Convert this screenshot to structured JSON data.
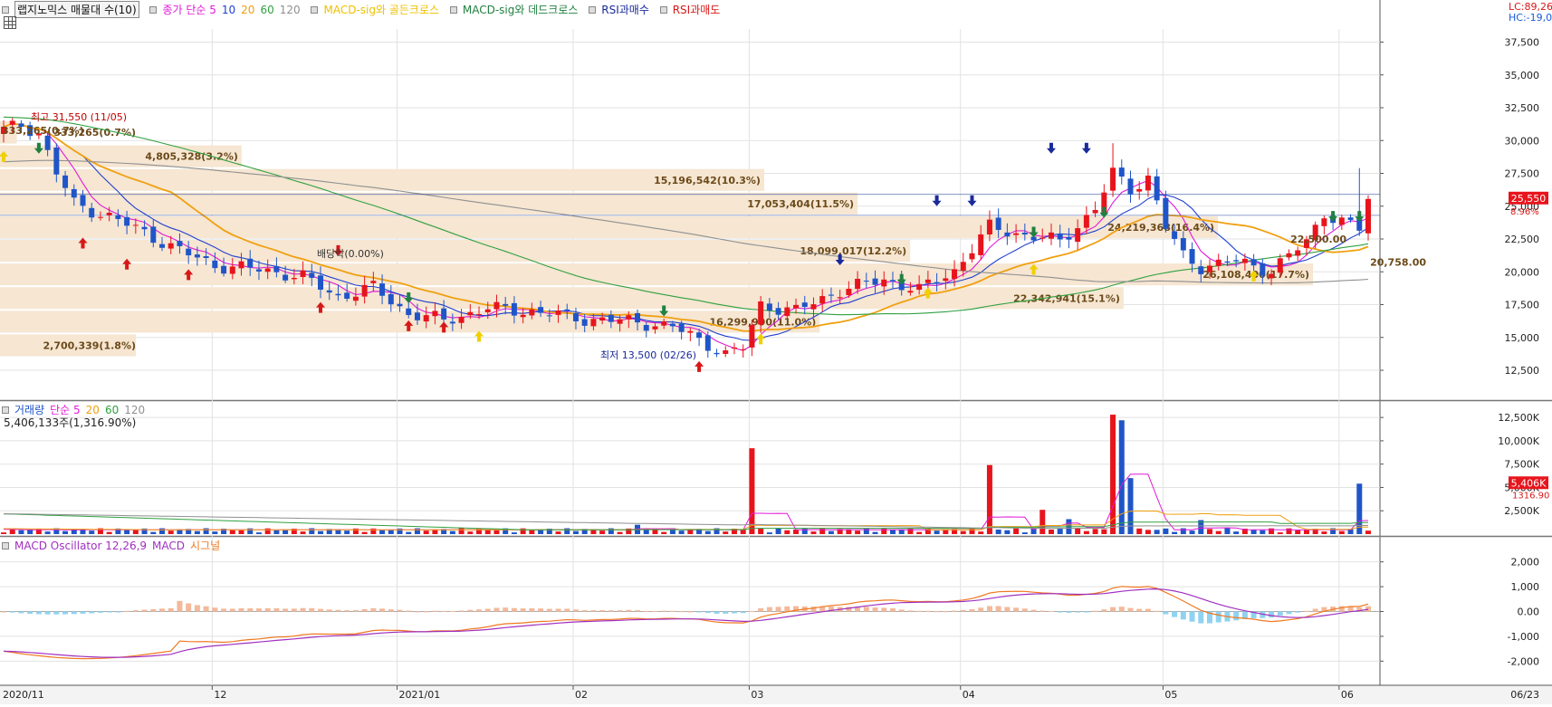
{
  "price_legend": {
    "title_btn": "랩지노믹스 매물대 수(10)",
    "ma_label": "종가 단순 5",
    "ma10": "10",
    "ma20": "20",
    "ma60": "60",
    "ma120": "120",
    "macd_golden": "MACD-sig와 골든크로스",
    "macd_dead": "MACD-sig와 데드크로스",
    "rsi_buy": "RSI과매수",
    "rsi_sell": "RSI과매도"
  },
  "volume_legend": {
    "label": "거래량",
    "ma_label": "단순 5",
    "ma20": "20",
    "ma60": "60",
    "ma120": "120",
    "summary": "5,406,133주(1,316.90%)"
  },
  "macd_legend": {
    "label": "MACD Oscillator 12,26,9",
    "macd": "MACD",
    "signal": "시그널"
  },
  "colors": {
    "up": "#e8141c",
    "down": "#1f55c8",
    "ma5": "#e01ad8",
    "ma10": "#2040d0",
    "ma20": "#f0a010",
    "ma60": "#30a040",
    "ma120": "#909090",
    "profile": "#f6e6d2",
    "osc_pos": "#f3b99b",
    "osc_neg": "#8fd3f0",
    "macd_line": "#a030c0",
    "signal_line": "#f07820"
  },
  "chart_data": [
    {
      "type": "candlestick",
      "title": "랩지노믹스",
      "ylim": [
        10500,
        38500
      ],
      "yticks": [
        "12,500",
        "15,000",
        "17,500",
        "20,000",
        "22,500",
        "25,000",
        "27,500",
        "30,000",
        "32,500",
        "35,000",
        "37,500"
      ],
      "xticks": [
        "2020/11",
        "12",
        "2021/01",
        "02",
        "03",
        "04",
        "05",
        "06",
        "06/23"
      ],
      "last_price_label": "25,550",
      "last_change_label": "8.96%",
      "corner_labels": [
        "LC:89,26",
        "HC:-19,0"
      ],
      "annotations": {
        "high": "최고 31,550 (11/05)",
        "low": "최저 13,500 (02/26)",
        "dividend": "배당락(0.00%)",
        "prev_label": "333,265(0.7%)"
      },
      "volume_profile": [
        {
          "lo": 13500,
          "hi": 15300,
          "volume": 2700339,
          "label": "2,700,339(1.8%)"
        },
        {
          "lo": 15300,
          "hi": 17100,
          "volume": 16299990,
          "label": "16,299,990(11.0%)"
        },
        {
          "lo": 17100,
          "hi": 18900,
          "volume": 22342941,
          "label": "22,342,941(15.1%)"
        },
        {
          "lo": 18900,
          "hi": 20700,
          "volume": 26108400,
          "label": "26,108,400(17.7%)"
        },
        {
          "lo": 20700,
          "hi": 22500,
          "volume": 18099017,
          "label": "18,099,017(12.2%)"
        },
        {
          "lo": 22500,
          "hi": 24300,
          "volume": 24219368,
          "label": "24,219,368(16.4%)"
        },
        {
          "lo": 24300,
          "hi": 26100,
          "volume": 17053404,
          "label": "17,053,404(11.5%)"
        },
        {
          "lo": 26100,
          "hi": 27900,
          "volume": 15196542,
          "label": "15,196,542(10.3%)"
        },
        {
          "lo": 27900,
          "hi": 29700,
          "volume": 4805328,
          "label": "4,805,328(3.2%)"
        },
        {
          "lo": 29700,
          "hi": 31550,
          "volume": 333265,
          "label": "333,265(0.7%)"
        }
      ],
      "level_labels": [
        {
          "price": 22500,
          "label": "22,500.00"
        },
        {
          "price": 20758,
          "label": "20,758.00"
        }
      ],
      "ma_labels": [
        "5",
        "10",
        "20",
        "60",
        "120"
      ]
    },
    {
      "type": "bar",
      "title": "거래량",
      "ylim": [
        0,
        13000
      ],
      "yticks": [
        "2,500K",
        "5,000K",
        "7,500K",
        "10,000K",
        "12,500K"
      ],
      "last_label": "5,406K",
      "last_pct": "1316.90"
    },
    {
      "type": "bar",
      "title": "MACD Oscillator 12,26,9",
      "ylim": [
        -2900,
        2900
      ],
      "yticks": [
        "2,000",
        "1,000",
        "0.00",
        "-1,000",
        "-2,000"
      ]
    }
  ]
}
